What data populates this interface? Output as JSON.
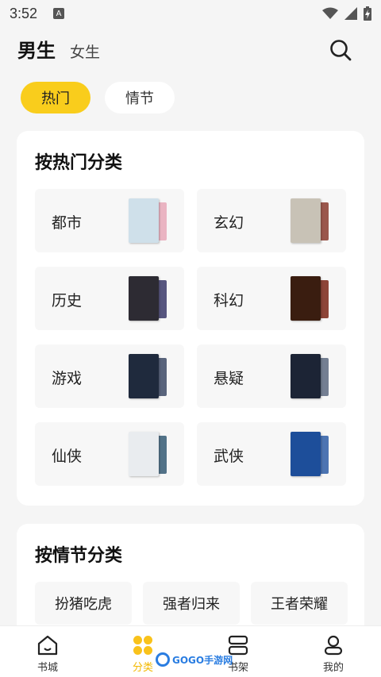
{
  "status_bar": {
    "time": "3:52",
    "notif_letter": "A"
  },
  "header": {
    "gender_tabs": [
      "男生",
      "女生"
    ],
    "active_gender": 0
  },
  "type_tabs": [
    "热门",
    "情节"
  ],
  "hot_section": {
    "title": "按热门分类",
    "categories": [
      {
        "name": "都市",
        "cover_front": "#cfe0ea",
        "cover_back": "#e7a8b8"
      },
      {
        "name": "玄幻",
        "cover_front": "#c8c2b6",
        "cover_back": "#8a3b2e"
      },
      {
        "name": "历史",
        "cover_front": "#2d2b33",
        "cover_back": "#3b3a6a"
      },
      {
        "name": "科幻",
        "cover_front": "#3a1d10",
        "cover_back": "#7a2616"
      },
      {
        "name": "游戏",
        "cover_front": "#1f2a3d",
        "cover_back": "#3d4a66"
      },
      {
        "name": "悬疑",
        "cover_front": "#1c2435",
        "cover_back": "#5d6a80"
      },
      {
        "name": "仙侠",
        "cover_front": "#e9ecef",
        "cover_back": "#355b74"
      },
      {
        "name": "武侠",
        "cover_front": "#1d4e9a",
        "cover_back": "#2e5da6"
      }
    ]
  },
  "plot_section": {
    "title": "按情节分类",
    "tags": [
      "扮猪吃虎",
      "强者归来",
      "王者荣耀"
    ]
  },
  "bottom_nav": {
    "items": [
      "书城",
      "分类",
      "书架",
      "我的"
    ],
    "active": 1
  },
  "watermark": {
    "text": "GOGO手游网"
  }
}
